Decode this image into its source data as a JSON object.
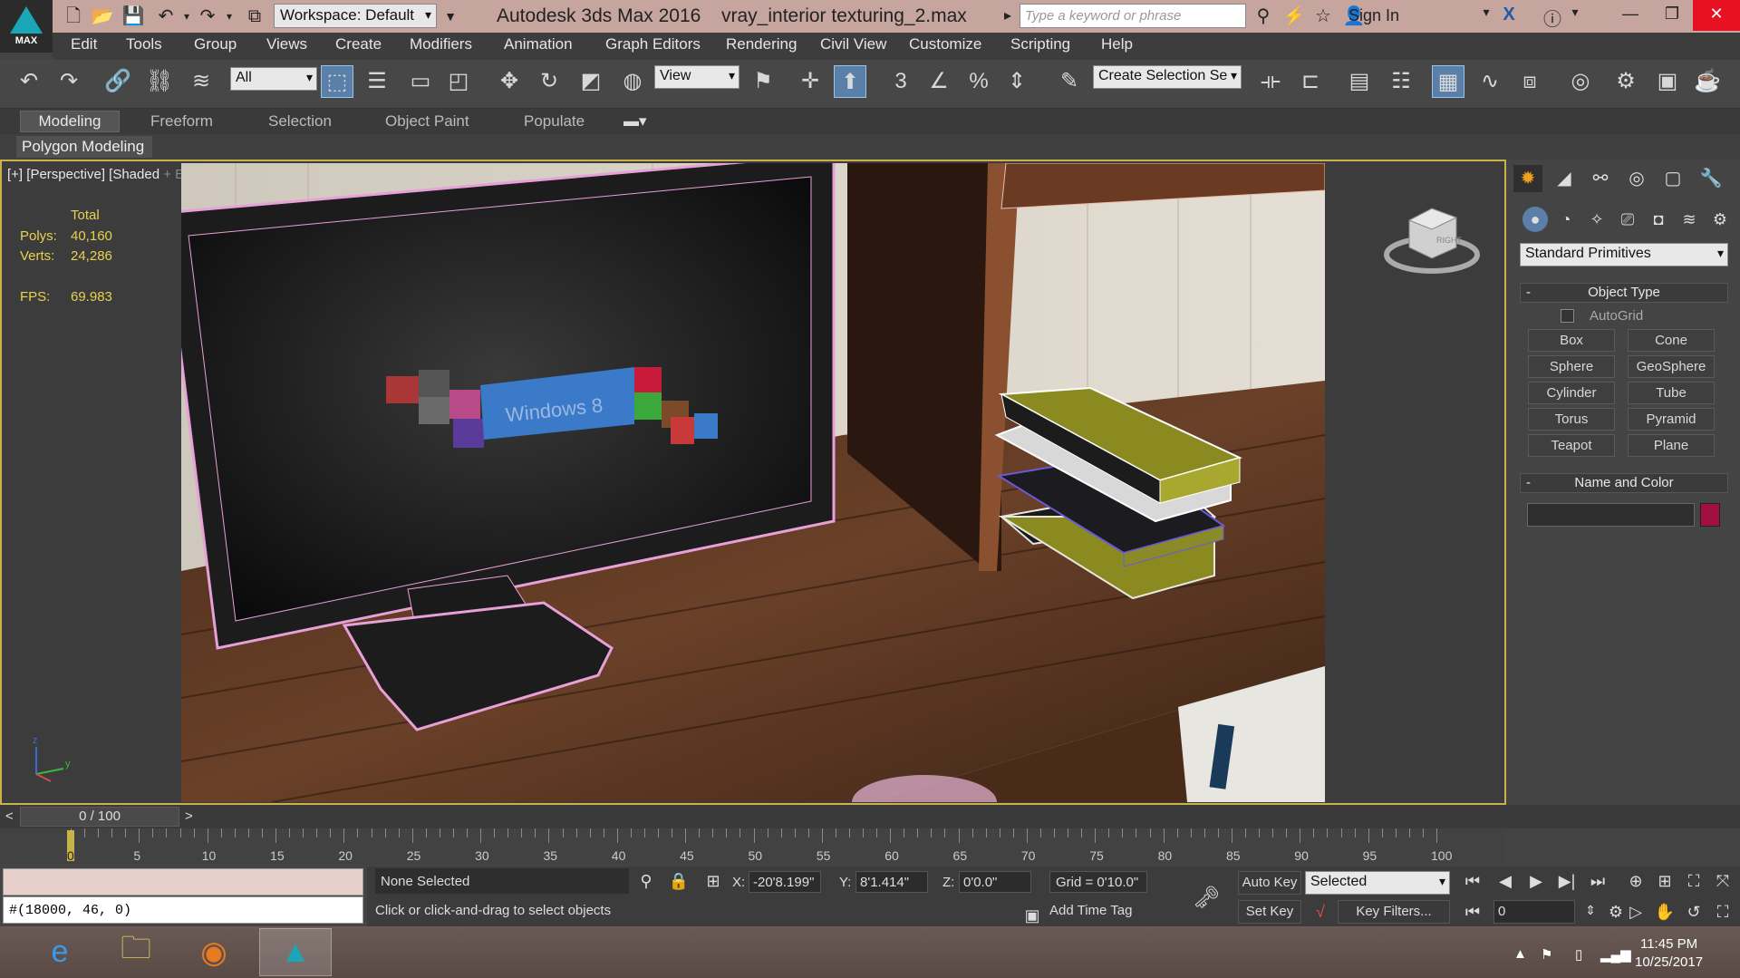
{
  "app": {
    "logo_text": "MAX",
    "workspace": "Workspace: Default",
    "title": "Autodesk 3ds Max 2016",
    "file": "vray_interior texturing_2.max",
    "search_placeholder": "Type a keyword or phrase",
    "sign_in": "Sign In"
  },
  "menu": [
    "Edit",
    "Tools",
    "Group",
    "Views",
    "Create",
    "Modifiers",
    "Animation",
    "Graph Editors",
    "Rendering",
    "Civil View",
    "Customize",
    "Scripting",
    "Help"
  ],
  "toolbar": {
    "filter": "All",
    "ref_coord": "View",
    "selection_set": "Create Selection Se",
    "snap_label": "3"
  },
  "ribbon": {
    "tabs": [
      "Modeling",
      "Freeform",
      "Selection",
      "Object Paint",
      "Populate"
    ],
    "panel": "Polygon Modeling"
  },
  "viewport": {
    "label_plus": "[+]",
    "label_view": "[Perspective]",
    "label_shade": "[Shaded",
    "label_edged": "+ Edged Faces ]",
    "stats": {
      "total": "Total",
      "polys_label": "Polys:",
      "polys": "40,160",
      "verts_label": "Verts:",
      "verts": "24,286",
      "fps_label": "FPS:",
      "fps": "69.983"
    },
    "screen_text": "Windows 8",
    "viewcube_face": "RIGHT",
    "axis": {
      "z": "z",
      "y": "y",
      "x": "x"
    }
  },
  "command_panel": {
    "category": "Standard Primitives",
    "object_type": "Object Type",
    "autogrid": "AutoGrid",
    "buttons": [
      "Box",
      "Cone",
      "Sphere",
      "GeoSphere",
      "Cylinder",
      "Tube",
      "Torus",
      "Pyramid",
      "Teapot",
      "Plane"
    ],
    "name_and_color": "Name and Color",
    "rollout_toggle": "-",
    "color": "#a01040"
  },
  "timeline": {
    "frame_display": "0 / 100",
    "prev": "<",
    "next": ">",
    "labels": [
      "5",
      "10",
      "15",
      "20",
      "25",
      "30",
      "35",
      "40",
      "45",
      "50",
      "55",
      "60",
      "65",
      "70",
      "75",
      "80",
      "85",
      "90",
      "95",
      "100"
    ],
    "start_label": "0"
  },
  "status": {
    "script_output": "#(18000, 46, 0)",
    "selection": "None Selected",
    "prompt": "Click or click-and-drag to select objects",
    "x_label": "X:",
    "x": "-20'8.199\"",
    "y_label": "Y:",
    "y": "8'1.414\"",
    "z_label": "Z:",
    "z": "0'0.0\"",
    "grid": "Grid = 0'10.0\"",
    "add_time_tag": "Add Time Tag",
    "auto_key": "Auto Key",
    "set_key": "Set Key",
    "key_mode": "Selected",
    "key_filters": "Key Filters...",
    "frame": "0"
  },
  "taskbar": {
    "time": "11:45 PM",
    "date": "10/25/2017"
  }
}
